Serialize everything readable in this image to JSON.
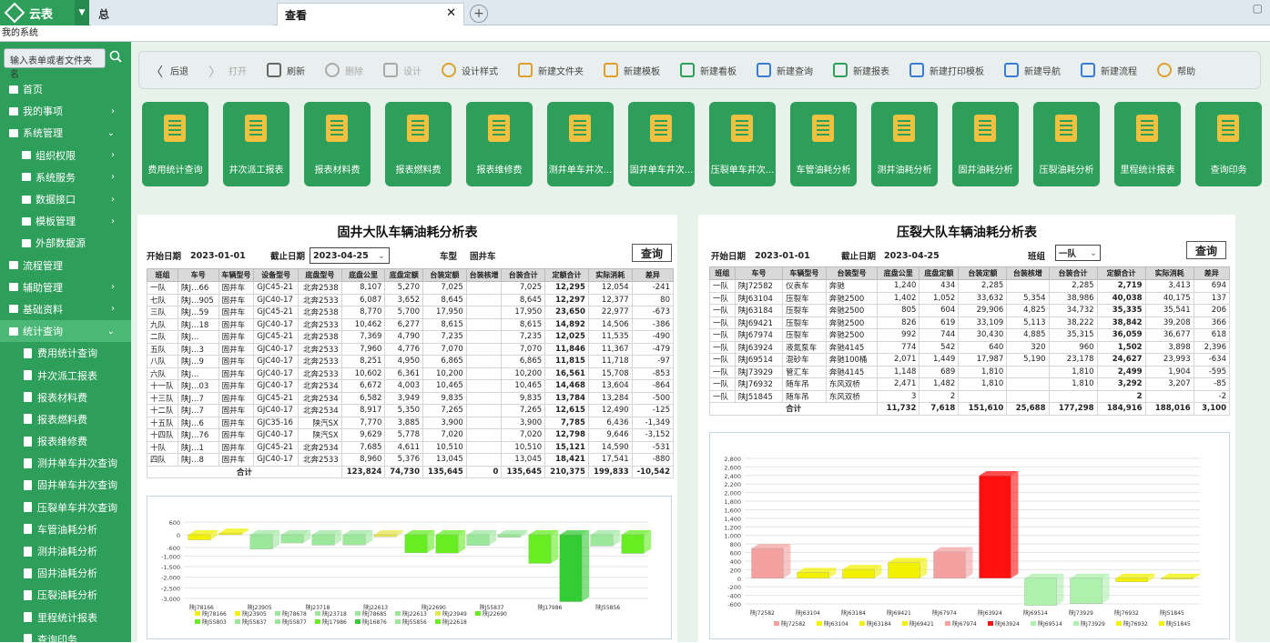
{
  "app": {
    "title": "云表",
    "tab_active": "查看",
    "tab_inactive": "总",
    "system_label": "我的系统"
  },
  "sidebar": {
    "search_placeholder": "输入表单或者文件夹名",
    "items": [
      {
        "label": "首页",
        "level": 0,
        "arrow": ""
      },
      {
        "label": "我的事项",
        "level": 0,
        "arrow": "›"
      },
      {
        "label": "系统管理",
        "level": 0,
        "arrow": "⌄"
      },
      {
        "label": "组织权限",
        "level": 1,
        "arrow": "›"
      },
      {
        "label": "系统服务",
        "level": 1,
        "arrow": "›"
      },
      {
        "label": "数据接口",
        "level": 1,
        "arrow": "›"
      },
      {
        "label": "模板管理",
        "level": 1,
        "arrow": "›"
      },
      {
        "label": "外部数据源",
        "level": 1,
        "arrow": ""
      },
      {
        "label": "流程管理",
        "level": 0,
        "arrow": ""
      },
      {
        "label": "辅助管理",
        "level": 0,
        "arrow": "›"
      },
      {
        "label": "基础资料",
        "level": 0,
        "arrow": "›"
      },
      {
        "label": "统计查询",
        "level": 0,
        "arrow": "⌄",
        "selected": true
      },
      {
        "label": "费用统计查询",
        "level": 2,
        "arrow": ""
      },
      {
        "label": "井次派工报表",
        "level": 2,
        "arrow": ""
      },
      {
        "label": "报表材料费",
        "level": 2,
        "arrow": ""
      },
      {
        "label": "报表燃料费",
        "level": 2,
        "arrow": ""
      },
      {
        "label": "报表维修费",
        "level": 2,
        "arrow": ""
      },
      {
        "label": "测井单车井次查询",
        "level": 2,
        "arrow": ""
      },
      {
        "label": "固井单车井次查询",
        "level": 2,
        "arrow": ""
      },
      {
        "label": "压裂单车井次查询",
        "level": 2,
        "arrow": ""
      },
      {
        "label": "车管油耗分析",
        "level": 2,
        "arrow": ""
      },
      {
        "label": "测井油耗分析",
        "level": 2,
        "arrow": ""
      },
      {
        "label": "固井油耗分析",
        "level": 2,
        "arrow": ""
      },
      {
        "label": "压裂油耗分析",
        "level": 2,
        "arrow": ""
      },
      {
        "label": "里程统计报表",
        "level": 2,
        "arrow": ""
      },
      {
        "label": "查询印务",
        "level": 2,
        "arrow": ""
      }
    ]
  },
  "toolbar": [
    {
      "label": "后退",
      "icon": "back-icon",
      "enabled": true
    },
    {
      "label": "打开",
      "icon": "forward-icon",
      "enabled": false
    },
    {
      "label": "刷新",
      "icon": "refresh-icon",
      "enabled": true
    },
    {
      "label": "删除",
      "icon": "delete-icon",
      "enabled": false
    },
    {
      "label": "设计",
      "icon": "edit-icon",
      "enabled": false
    },
    {
      "label": "设计样式",
      "icon": "palette-icon",
      "enabled": true
    },
    {
      "label": "新建文件夹",
      "icon": "new-folder-icon",
      "enabled": true
    },
    {
      "label": "新建模板",
      "icon": "new-template-icon",
      "enabled": true
    },
    {
      "label": "新建看板",
      "icon": "new-board-icon",
      "enabled": true
    },
    {
      "label": "新建查询",
      "icon": "new-query-icon",
      "enabled": true
    },
    {
      "label": "新建报表",
      "icon": "new-report-icon",
      "enabled": true
    },
    {
      "label": "新建打印模板",
      "icon": "new-print-icon",
      "enabled": true
    },
    {
      "label": "新建导航",
      "icon": "new-nav-icon",
      "enabled": true
    },
    {
      "label": "新建流程",
      "icon": "new-flow-icon",
      "enabled": true
    },
    {
      "label": "帮助",
      "icon": "help-icon",
      "enabled": true
    }
  ],
  "tiles": [
    "费用统计查询",
    "井次派工报表",
    "报表材料费",
    "报表燃料费",
    "报表维修费",
    "测井单车井次...",
    "固井单车井次...",
    "压裂单车井次...",
    "车管油耗分析",
    "测井油耗分析",
    "固井油耗分析",
    "压裂油耗分析",
    "里程统计报表",
    "查询印务"
  ],
  "report1": {
    "title": "固井大队车辆油耗分析表",
    "filter": {
      "start_label": "开始日期",
      "start": "2023-01-01",
      "end_label": "截止日期",
      "end": "2023-04-25",
      "type_label": "车型",
      "type": "固井车",
      "query": "查询"
    },
    "headers": [
      "班组",
      "车号",
      "车辆型号",
      "设备型号",
      "底盘型号",
      "底盘公里",
      "底盘定额",
      "台装定额",
      "台装核增",
      "台装合计",
      "定额合计",
      "实际消耗",
      "差异"
    ],
    "rows": [
      [
        "一队",
        "陕J…66",
        "固井车",
        "GJC45-21",
        "北奔2538",
        "8,107",
        "5,270",
        "7,025",
        "",
        "7,025",
        "12,295",
        "12,054",
        "-241"
      ],
      [
        "七队",
        "陕J…905",
        "固井车",
        "GJC40-17",
        "北奔2533",
        "6,087",
        "3,652",
        "8,645",
        "",
        "8,645",
        "12,297",
        "12,377",
        "80"
      ],
      [
        "三队",
        "陕J…59",
        "固井车",
        "GJC45-21",
        "北奔2538",
        "8,770",
        "5,700",
        "17,950",
        "",
        "17,950",
        "23,650",
        "22,977",
        "-673"
      ],
      [
        "九队",
        "陕J…18",
        "固井车",
        "GJC40-17",
        "北奔2533",
        "10,462",
        "6,277",
        "8,615",
        "",
        "8,615",
        "14,892",
        "14,506",
        "-386"
      ],
      [
        "二队",
        "陕J…",
        "固井车",
        "GJC45-21",
        "北奔2538",
        "7,369",
        "4,790",
        "7,235",
        "",
        "7,235",
        "12,025",
        "11,535",
        "-490"
      ],
      [
        "五队",
        "陕J…3",
        "固井车",
        "GJC40-17",
        "北奔2533",
        "7,960",
        "4,776",
        "7,070",
        "",
        "7,070",
        "11,846",
        "11,367",
        "-479"
      ],
      [
        "八队",
        "陕J…9",
        "固井车",
        "GJC40-17",
        "北奔2533",
        "8,251",
        "4,950",
        "6,865",
        "",
        "6,865",
        "11,815",
        "11,718",
        "-97"
      ],
      [
        "六队",
        "陕J…",
        "固井车",
        "GJC40-17",
        "北奔2533",
        "10,602",
        "6,361",
        "10,200",
        "",
        "10,200",
        "16,561",
        "15,708",
        "-853"
      ],
      [
        "十一队",
        "陕J…03",
        "固井车",
        "GJC40-17",
        "北奔2534",
        "6,672",
        "4,003",
        "10,465",
        "",
        "10,465",
        "14,468",
        "13,604",
        "-864"
      ],
      [
        "十三队",
        "陕J…7",
        "固井车",
        "GJC45-21",
        "北奔2534",
        "6,582",
        "3,949",
        "9,835",
        "",
        "9,835",
        "13,784",
        "13,284",
        "-500"
      ],
      [
        "十二队",
        "陕J…7",
        "固井车",
        "GJC40-17",
        "北奔2534",
        "8,917",
        "5,350",
        "7,265",
        "",
        "7,265",
        "12,615",
        "12,490",
        "-125"
      ],
      [
        "十五队",
        "陕J…6",
        "固井车",
        "GJC35-16",
        "陕汽SX",
        "7,770",
        "3,885",
        "3,900",
        "",
        "3,900",
        "7,785",
        "6,436",
        "-1,349"
      ],
      [
        "十四队",
        "陕J…76",
        "固井车",
        "GJC40-17",
        "陕汽SX",
        "9,629",
        "5,778",
        "7,020",
        "",
        "7,020",
        "12,798",
        "9,646",
        "-3,152"
      ],
      [
        "十队",
        "陕J…1",
        "固井车",
        "GJC45-21",
        "北奔2534",
        "7,685",
        "4,611",
        "10,510",
        "",
        "10,510",
        "15,121",
        "14,590",
        "-531"
      ],
      [
        "四队",
        "陕J…8",
        "固井车",
        "GJC40-17",
        "北奔2533",
        "8,960",
        "5,376",
        "13,045",
        "",
        "13,045",
        "18,421",
        "17,541",
        "-880"
      ]
    ],
    "total": [
      "合计",
      "123,824",
      "74,730",
      "135,645",
      "0",
      "135,645",
      "210,375",
      "199,833",
      "-10,542"
    ]
  },
  "report2": {
    "title": "压裂大队车辆油耗分析表",
    "filter": {
      "start_label": "开始日期",
      "start": "2023-01-01",
      "end_label": "截止日期",
      "end": "2023-04-25",
      "team_label": "班组",
      "team": "一队",
      "query": "查询"
    },
    "headers": [
      "班组",
      "车号",
      "车辆型号",
      "台装型号",
      "底盘公里",
      "底盘定额",
      "台装定额",
      "台装核增",
      "台装合计",
      "定额合计",
      "实际消耗",
      "差异"
    ],
    "rows": [
      [
        "一队",
        "陕J72582",
        "仪表车",
        "奔驰",
        "1,240",
        "434",
        "2,285",
        "",
        "2,285",
        "2,719",
        "3,413",
        "694"
      ],
      [
        "一队",
        "陕J63104",
        "压裂车",
        "奔驰2500",
        "1,402",
        "1,052",
        "33,632",
        "5,354",
        "38,986",
        "40,038",
        "40,175",
        "137"
      ],
      [
        "一队",
        "陕J63184",
        "压裂车",
        "奔驰2500",
        "805",
        "604",
        "29,906",
        "4,825",
        "34,732",
        "35,335",
        "35,541",
        "206"
      ],
      [
        "一队",
        "陕J69421",
        "压裂车",
        "奔驰2500",
        "826",
        "619",
        "33,109",
        "5,113",
        "38,222",
        "38,842",
        "39,208",
        "366"
      ],
      [
        "一队",
        "陕J67974",
        "压裂车",
        "奔驰2500",
        "992",
        "744",
        "30,430",
        "4,885",
        "35,315",
        "36,059",
        "36,677",
        "618"
      ],
      [
        "一队",
        "陕J63924",
        "液氮泵车",
        "奔驰4145",
        "774",
        "542",
        "640",
        "320",
        "960",
        "1,502",
        "3,898",
        "2,396"
      ],
      [
        "一队",
        "陕J69514",
        "混砂车",
        "奔驰100桶",
        "2,071",
        "1,449",
        "17,987",
        "5,190",
        "23,178",
        "24,627",
        "23,993",
        "-634"
      ],
      [
        "一队",
        "陕J73929",
        "管汇车",
        "奔驰4145",
        "1,148",
        "689",
        "1,810",
        "",
        "1,810",
        "2,499",
        "1,904",
        "-595"
      ],
      [
        "一队",
        "陕J76932",
        "随车吊",
        "东风双桥",
        "2,471",
        "1,482",
        "1,810",
        "",
        "1,810",
        "3,292",
        "3,207",
        "-85"
      ],
      [
        "一队",
        "陕J51845",
        "随车吊",
        "东风双桥",
        "3",
        "2",
        "",
        "",
        "",
        "2",
        "",
        "-2"
      ]
    ],
    "total": [
      "合计",
      "11,732",
      "7,618",
      "151,610",
      "25,688",
      "177,298",
      "184,916",
      "188,016",
      "3,100"
    ]
  },
  "chart_data": [
    {
      "type": "bar",
      "title": "",
      "ylim": [
        -3000,
        600
      ],
      "yticks": [
        "600",
        "0",
        "-600",
        "-1,000",
        "-1,500",
        "-2,000",
        "-2,500",
        "-3,000"
      ],
      "categories": [
        "陕J7…66",
        "陕J23905",
        "陕J78678",
        "陕J23718",
        "陕J78685",
        "陕J22613",
        "陕J23949",
        "陕J22690",
        "陕J55803",
        "陕J55837",
        "陕J17986",
        "陕J16876",
        "陕J55856",
        "陕J22618",
        "陕J55877"
      ],
      "xticks": [
        "陕J78166",
        "陕J23905",
        "陕J23718",
        "陕J22613",
        "陕J22690",
        "陕J55837",
        "陕J17986",
        "陕J55856"
      ],
      "values": [
        -241,
        80,
        -673,
        -386,
        -490,
        -479,
        -97,
        -853,
        -864,
        -500,
        -125,
        -1349,
        -3152,
        -531,
        -880
      ],
      "colors": [
        "#f2f200",
        "#f2f200",
        "#9be89b",
        "#9be89b",
        "#9be89b",
        "#9be89b",
        "#e6e64d",
        "#66ee22",
        "#66ee22",
        "#9be89b",
        "#9be89b",
        "#66ee22",
        "#33cc33",
        "#9be89b",
        "#66ee22"
      ],
      "legend": [
        "陕J78166",
        "陕J23905",
        "陕J78678",
        "陕J23718",
        "陕J78685",
        "陕J22613",
        "陕J23949",
        "陕J22690",
        "陕J55803",
        "陕J55837",
        "陕J55877",
        "陕J17986",
        "陕J16876",
        "陕J55856",
        "陕J22618"
      ]
    },
    {
      "type": "bar",
      "title": "",
      "ylim": [
        -600,
        2800
      ],
      "yticks": [
        "2,800",
        "2,600",
        "2,400",
        "2,200",
        "2,000",
        "1,800",
        "1,600",
        "1,400",
        "1,200",
        "1,000",
        "800",
        "600",
        "400",
        "200",
        "0",
        "-200",
        "-400",
        "-600"
      ],
      "categories": [
        "陕J72582",
        "陕J63104",
        "陕J63184",
        "陕J69421",
        "陕J67974",
        "陕J63924",
        "陕J69514",
        "陕J73929",
        "陕J76932",
        "陕J51845"
      ],
      "values": [
        694,
        137,
        206,
        366,
        618,
        2396,
        -634,
        -595,
        -85,
        -2
      ],
      "colors": [
        "#f4a0a0",
        "#f2f200",
        "#f2f200",
        "#f2f200",
        "#f4a0a0",
        "#ff1010",
        "#aef0ae",
        "#aef0ae",
        "#f2f200",
        "#f2f200"
      ],
      "legend": [
        "陕J72582",
        "陕J63104",
        "陕J63184",
        "陕J69421",
        "陕J67974",
        "陕J63924",
        "陕J69514",
        "陕J73929",
        "陕J76932",
        "陕J51845"
      ]
    }
  ]
}
